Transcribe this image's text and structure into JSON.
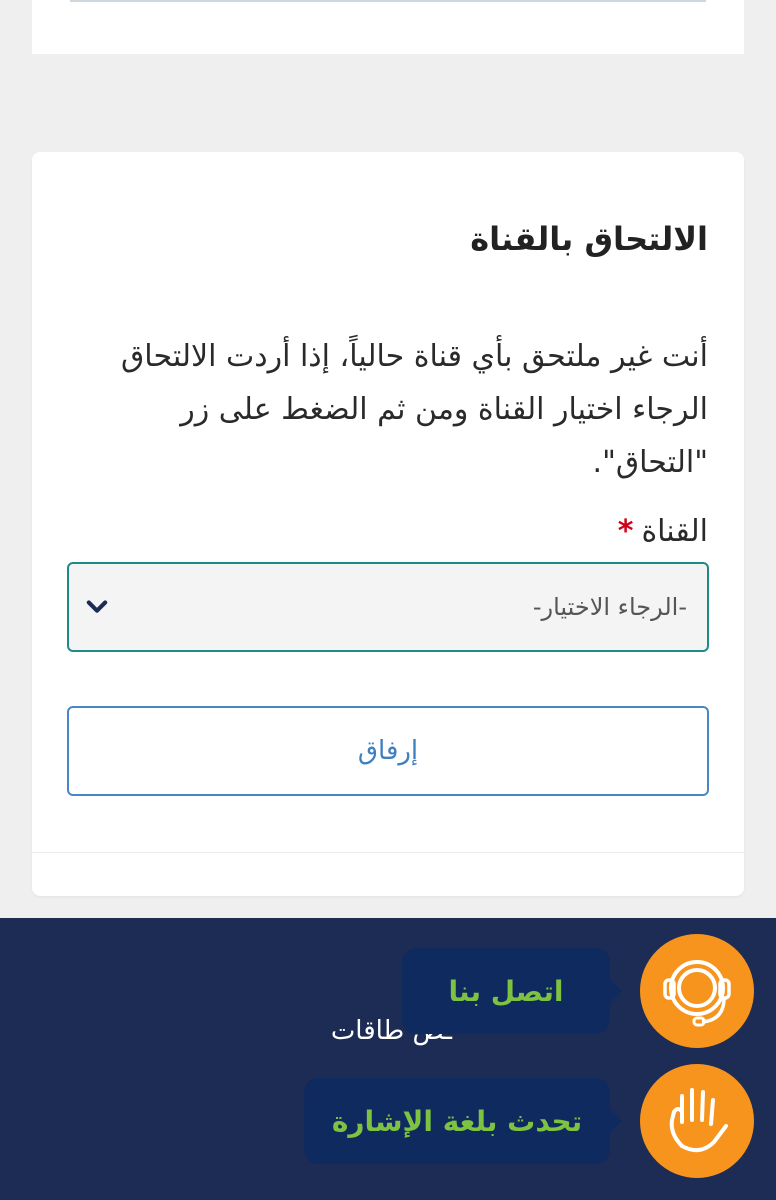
{
  "section": {
    "title": "الالتحاق بالقناة",
    "description": "أنت غير ملتحق بأي قناة حالياً، إذا أردت الالتحاق الرجاء اختيار القناة ومن ثم الضغط على زر \"التحاق\".",
    "field_label": "القناة",
    "required_mark": "*",
    "select_value": "-الرجاء الاختيار-",
    "attach_button": "إرفاق"
  },
  "footer": {
    "link_partial": "ـص طاقات",
    "contact_label": "اتصل بنا",
    "sign_language_label": "تحدث بلغة الإشارة"
  },
  "icons": {
    "select_chevron": "chevron-down-icon",
    "contact": "headset-icon",
    "sign_language": "hand-icon"
  },
  "colors": {
    "select_border": "#1f8a87",
    "button_border": "#4a86c6",
    "footer_bg": "#1c2c55",
    "floating_accent": "#f7941d",
    "floating_label": "#7ec242",
    "required": "#d0021b"
  }
}
